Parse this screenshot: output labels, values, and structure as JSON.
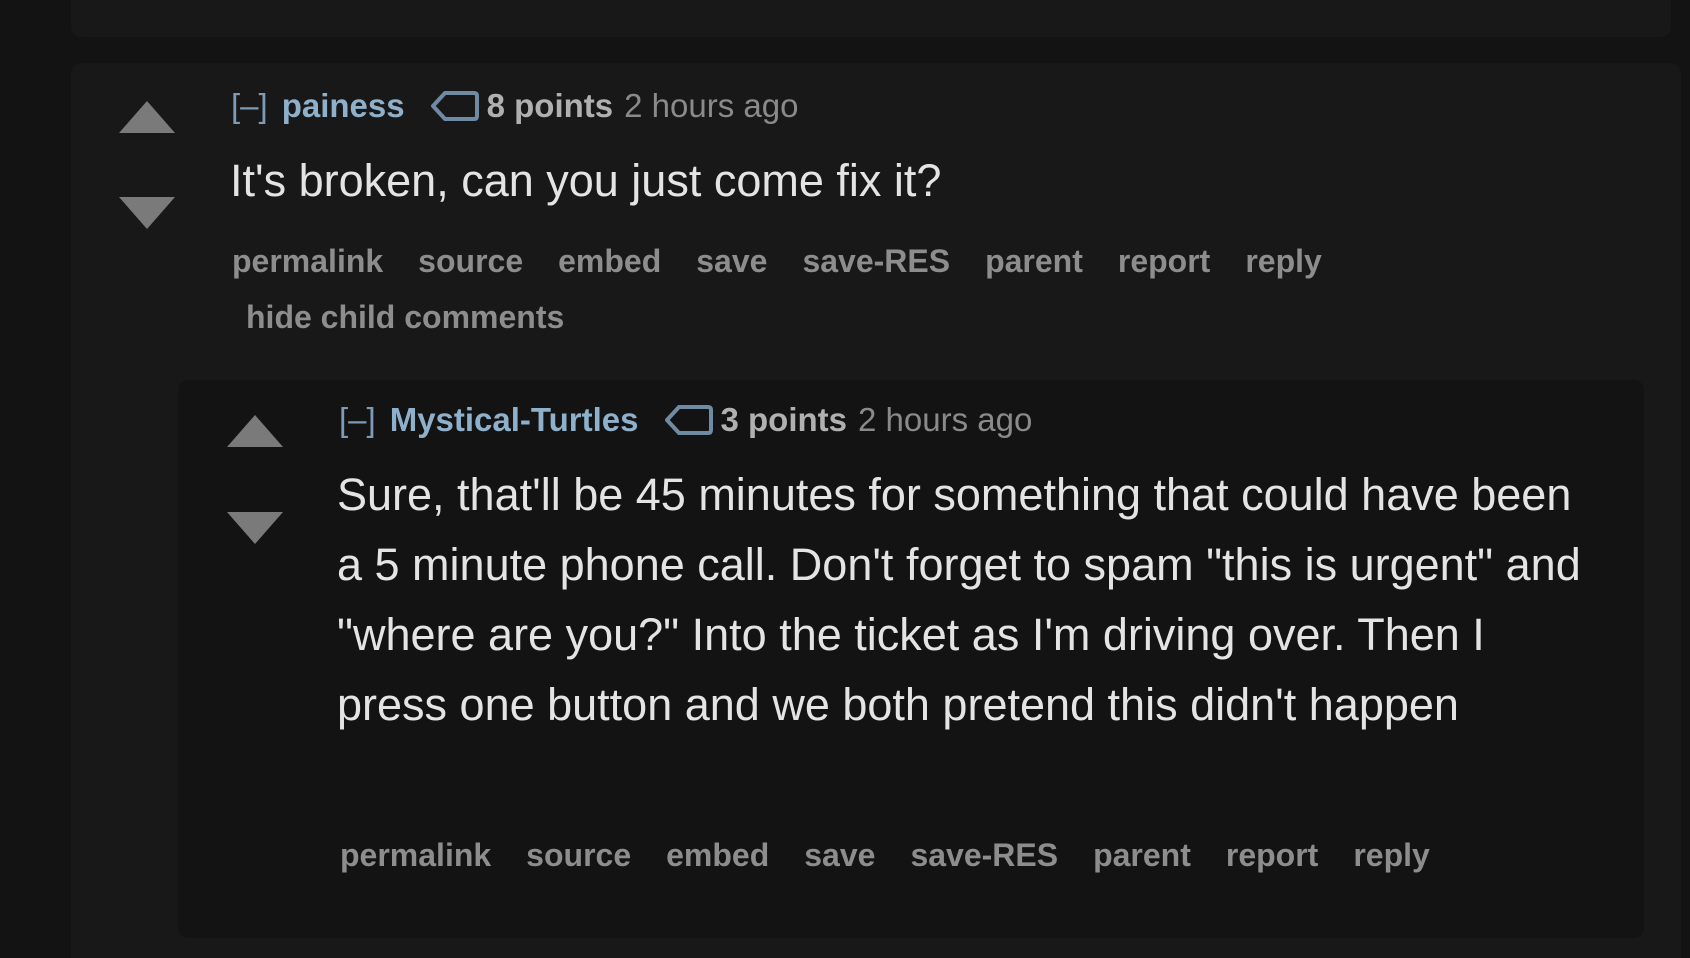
{
  "comments": [
    {
      "toggle": "[–]",
      "author": "painess",
      "points": "8 points",
      "age": "2 hours ago",
      "body": "It's broken, can you just come fix it?",
      "actions": [
        "permalink",
        "source",
        "embed",
        "save",
        "save-RES",
        "parent",
        "report",
        "reply"
      ],
      "extra_action": "hide child comments"
    },
    {
      "toggle": "[–]",
      "author": "Mystical-Turtles",
      "points": "3 points",
      "age": "2 hours ago",
      "body": "Sure, that'll be 45 minutes for something that could have been a 5 minute phone call. Don't forget to spam \"this is urgent\" and \"where are you?\" Into the ticket as I'm driving over. Then I press one button and we both pretend this didn't happen",
      "actions": [
        "permalink",
        "source",
        "embed",
        "save",
        "save-RES",
        "parent",
        "report",
        "reply"
      ]
    }
  ],
  "icons": {
    "upvote": "upvote-arrow-icon",
    "downvote": "downvote-arrow-icon",
    "tag": "user-tag-icon"
  },
  "colors": {
    "background": "#131313",
    "card": "#181818",
    "author": "#8fb0ca",
    "body_text": "#e4e4e4",
    "action_text": "#8d8d8d"
  }
}
